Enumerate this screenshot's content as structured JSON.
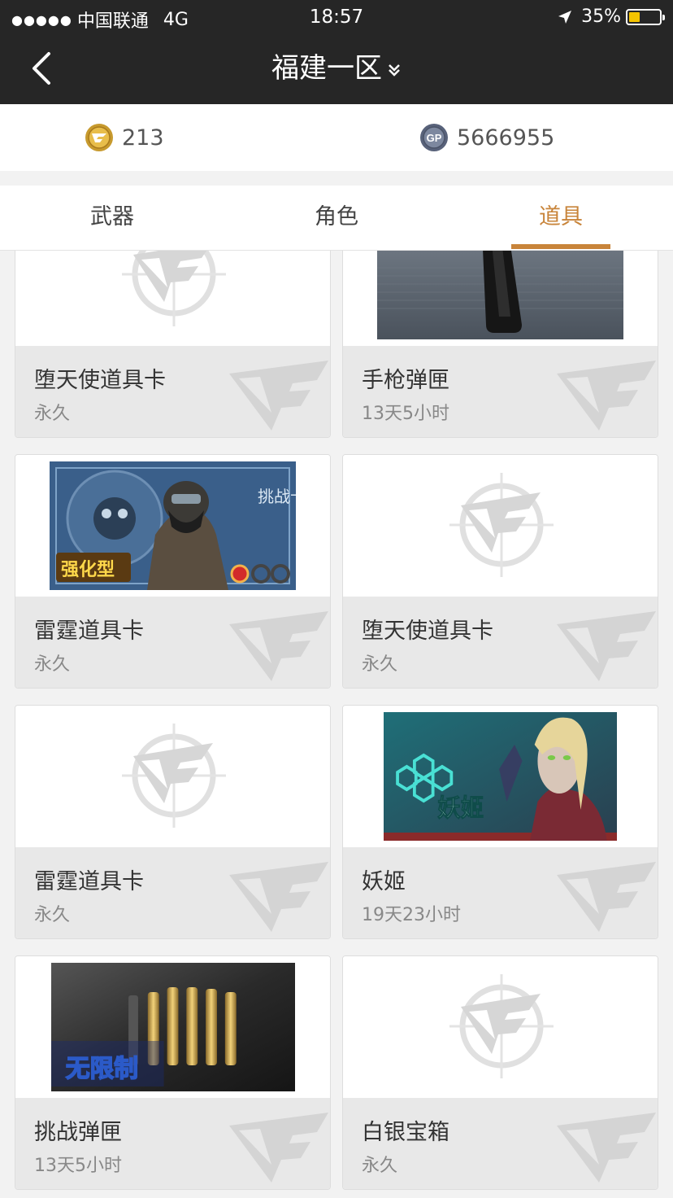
{
  "status_bar": {
    "signal": "●●●●●",
    "carrier": "中国联通",
    "network": "4G",
    "time": "18:57",
    "battery": "35%",
    "battery_level": 0.35
  },
  "nav": {
    "title": "福建一区"
  },
  "currency": {
    "coin_amount": "213",
    "gp_amount": "5666955",
    "gp_label": "GP"
  },
  "tabs": [
    {
      "label": "武器",
      "active": false
    },
    {
      "label": "角色",
      "active": false
    },
    {
      "label": "道具",
      "active": true
    }
  ],
  "items": [
    {
      "name": "堕天使道具卡",
      "duration": "永久",
      "image": "cf-placeholder-logo"
    },
    {
      "name": "手枪弹匣",
      "duration": "13天5小时",
      "image": "pistol-magazine"
    },
    {
      "name": "雷霆道具卡",
      "duration": "永久",
      "image": "soldier-card"
    },
    {
      "name": "堕天使道具卡",
      "duration": "永久",
      "image": "cf-placeholder-logo"
    },
    {
      "name": "雷霆道具卡",
      "duration": "永久",
      "image": "cf-placeholder-logo"
    },
    {
      "name": "妖姬",
      "duration": "19天23小时",
      "image": "character-portrait"
    },
    {
      "name": "挑战弹匣",
      "duration": "13天5小时",
      "image": "ammo-bullets"
    },
    {
      "name": "白银宝箱",
      "duration": "永久",
      "image": "cf-placeholder-logo"
    }
  ],
  "thumb_text": {
    "soldier_badge": "强化型",
    "soldier_side": "挑战卡",
    "character_name": "妖姬",
    "ammo_label": "无限制"
  },
  "colors": {
    "accent": "#c8843a",
    "header_bg": "#262626",
    "card_info_bg": "#e8e8e8"
  }
}
